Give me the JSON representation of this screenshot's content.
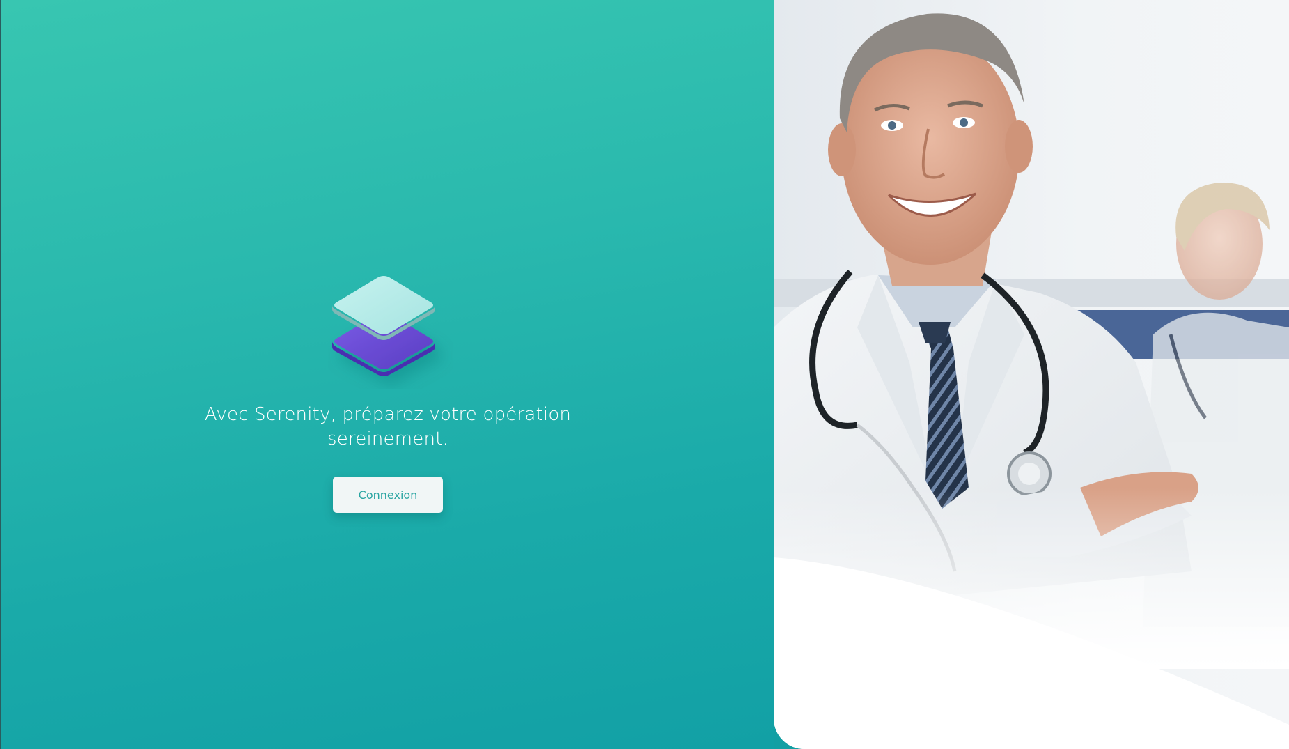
{
  "app": {
    "brand": "Serenity"
  },
  "hero": {
    "tagline_line1": "Avec Serenity, préparez votre opération",
    "tagline_line2": "sereinement.",
    "login_label": "Connexion",
    "logo_icon": "layers-icon"
  },
  "photo": {
    "subject_icon": "doctor-photo"
  },
  "colors": {
    "primary_teal": "#2ab9ae",
    "teal_dark": "#12a0a5",
    "logo_top": "#b3ebe8",
    "logo_bottom": "#6d4fd8",
    "button_text": "#2aa5a2"
  }
}
